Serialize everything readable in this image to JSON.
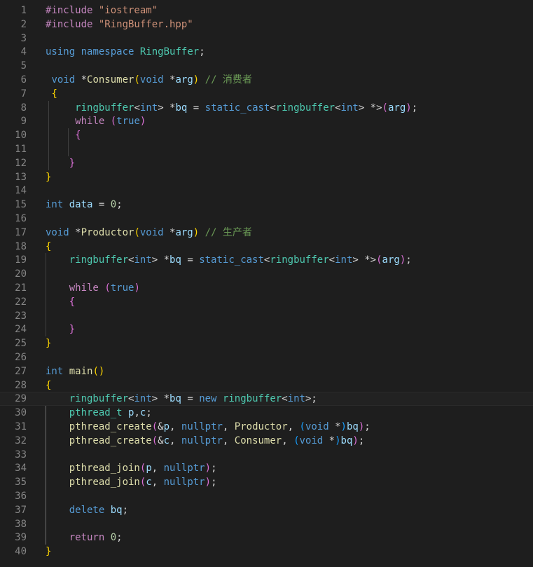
{
  "editor": {
    "language": "cpp",
    "theme_colors": {
      "background": "#1e1e1e",
      "line_number": "#858585",
      "keyword": "#569cd6",
      "control": "#c586c0",
      "type": "#4ec9b0",
      "function": "#dcdcaa",
      "variable": "#9cdcfe",
      "string": "#ce9178",
      "number": "#b5cea8",
      "comment": "#6a9955",
      "bracket_level_1": "#ffd700",
      "bracket_level_2": "#da70d6",
      "bracket_level_3": "#179fff"
    },
    "current_line": 29,
    "lines": [
      {
        "n": "1",
        "tokens": [
          [
            "pp",
            "#include "
          ],
          [
            "str",
            "\"iostream\""
          ]
        ]
      },
      {
        "n": "2",
        "tokens": [
          [
            "pp",
            "#include "
          ],
          [
            "str",
            "\"RingBuffer.hpp\""
          ]
        ]
      },
      {
        "n": "3",
        "tokens": []
      },
      {
        "n": "4",
        "tokens": [
          [
            "kw",
            "using"
          ],
          [
            "plain",
            " "
          ],
          [
            "kw",
            "namespace"
          ],
          [
            "plain",
            " "
          ],
          [
            "ty",
            "RingBuffer"
          ],
          [
            "plain",
            ";"
          ]
        ]
      },
      {
        "n": "5",
        "tokens": []
      },
      {
        "n": "6",
        "tokens": [
          [
            "plain",
            " "
          ],
          [
            "kw",
            "void"
          ],
          [
            "plain",
            " *"
          ],
          [
            "fn",
            "Consumer"
          ],
          [
            "b1",
            "("
          ],
          [
            "kw",
            "void"
          ],
          [
            "plain",
            " *"
          ],
          [
            "var",
            "arg"
          ],
          [
            "b1",
            ")"
          ],
          [
            "plain",
            " "
          ],
          [
            "cmt",
            "// 消费者"
          ]
        ]
      },
      {
        "n": "7",
        "tokens": [
          [
            "plain",
            " "
          ],
          [
            "b1",
            "{"
          ]
        ]
      },
      {
        "n": "8",
        "tokens": [
          [
            "plain",
            "     "
          ],
          [
            "ty",
            "ringbuffer"
          ],
          [
            "plain",
            "<"
          ],
          [
            "kw",
            "int"
          ],
          [
            "plain",
            "> *"
          ],
          [
            "var",
            "bq"
          ],
          [
            "plain",
            " = "
          ],
          [
            "kw",
            "static_cast"
          ],
          [
            "plain",
            "<"
          ],
          [
            "ty",
            "ringbuffer"
          ],
          [
            "plain",
            "<"
          ],
          [
            "kw",
            "int"
          ],
          [
            "plain",
            "> *>"
          ],
          [
            "b2",
            "("
          ],
          [
            "var",
            "arg"
          ],
          [
            "b2",
            ")"
          ],
          [
            "plain",
            ";"
          ]
        ]
      },
      {
        "n": "9",
        "tokens": [
          [
            "plain",
            "     "
          ],
          [
            "ctl",
            "while"
          ],
          [
            "plain",
            " "
          ],
          [
            "b2",
            "("
          ],
          [
            "kw",
            "true"
          ],
          [
            "b2",
            ")"
          ]
        ]
      },
      {
        "n": "10",
        "tokens": [
          [
            "plain",
            "     "
          ],
          [
            "b2",
            "{"
          ]
        ]
      },
      {
        "n": "11",
        "tokens": []
      },
      {
        "n": "12",
        "tokens": [
          [
            "plain",
            "    "
          ],
          [
            "b2",
            "}"
          ]
        ]
      },
      {
        "n": "13",
        "tokens": [
          [
            "b1",
            "}"
          ]
        ]
      },
      {
        "n": "14",
        "tokens": []
      },
      {
        "n": "15",
        "tokens": [
          [
            "kw",
            "int"
          ],
          [
            "plain",
            " "
          ],
          [
            "var",
            "data"
          ],
          [
            "plain",
            " = "
          ],
          [
            "num",
            "0"
          ],
          [
            "plain",
            ";"
          ]
        ]
      },
      {
        "n": "16",
        "tokens": []
      },
      {
        "n": "17",
        "tokens": [
          [
            "kw",
            "void"
          ],
          [
            "plain",
            " *"
          ],
          [
            "fn",
            "Productor"
          ],
          [
            "b1",
            "("
          ],
          [
            "kw",
            "void"
          ],
          [
            "plain",
            " *"
          ],
          [
            "var",
            "arg"
          ],
          [
            "b1",
            ")"
          ],
          [
            "plain",
            " "
          ],
          [
            "cmt",
            "// 生产者"
          ]
        ]
      },
      {
        "n": "18",
        "tokens": [
          [
            "b1",
            "{"
          ]
        ]
      },
      {
        "n": "19",
        "tokens": [
          [
            "plain",
            "    "
          ],
          [
            "ty",
            "ringbuffer"
          ],
          [
            "plain",
            "<"
          ],
          [
            "kw",
            "int"
          ],
          [
            "plain",
            "> *"
          ],
          [
            "var",
            "bq"
          ],
          [
            "plain",
            " = "
          ],
          [
            "kw",
            "static_cast"
          ],
          [
            "plain",
            "<"
          ],
          [
            "ty",
            "ringbuffer"
          ],
          [
            "plain",
            "<"
          ],
          [
            "kw",
            "int"
          ],
          [
            "plain",
            "> *>"
          ],
          [
            "b2",
            "("
          ],
          [
            "var",
            "arg"
          ],
          [
            "b2",
            ")"
          ],
          [
            "plain",
            ";"
          ]
        ]
      },
      {
        "n": "20",
        "tokens": []
      },
      {
        "n": "21",
        "tokens": [
          [
            "plain",
            "    "
          ],
          [
            "ctl",
            "while"
          ],
          [
            "plain",
            " "
          ],
          [
            "b2",
            "("
          ],
          [
            "kw",
            "true"
          ],
          [
            "b2",
            ")"
          ]
        ]
      },
      {
        "n": "22",
        "tokens": [
          [
            "plain",
            "    "
          ],
          [
            "b2",
            "{"
          ]
        ]
      },
      {
        "n": "23",
        "tokens": []
      },
      {
        "n": "24",
        "tokens": [
          [
            "plain",
            "    "
          ],
          [
            "b2",
            "}"
          ]
        ]
      },
      {
        "n": "25",
        "tokens": [
          [
            "b1",
            "}"
          ]
        ]
      },
      {
        "n": "26",
        "tokens": []
      },
      {
        "n": "27",
        "tokens": [
          [
            "kw",
            "int"
          ],
          [
            "plain",
            " "
          ],
          [
            "fn",
            "main"
          ],
          [
            "b1",
            "()"
          ]
        ]
      },
      {
        "n": "28",
        "tokens": [
          [
            "b1",
            "{"
          ]
        ]
      },
      {
        "n": "29",
        "tokens": [
          [
            "plain",
            "    "
          ],
          [
            "ty",
            "ringbuffer"
          ],
          [
            "plain",
            "<"
          ],
          [
            "kw",
            "int"
          ],
          [
            "plain",
            "> *"
          ],
          [
            "var",
            "bq"
          ],
          [
            "plain",
            " = "
          ],
          [
            "kw",
            "new"
          ],
          [
            "plain",
            " "
          ],
          [
            "ty",
            "ringbuffer"
          ],
          [
            "plain",
            "<"
          ],
          [
            "kw",
            "int"
          ],
          [
            "plain",
            ">;"
          ]
        ]
      },
      {
        "n": "30",
        "tokens": [
          [
            "plain",
            "    "
          ],
          [
            "ty",
            "pthread_t"
          ],
          [
            "plain",
            " "
          ],
          [
            "var",
            "p"
          ],
          [
            "plain",
            ","
          ],
          [
            "var",
            "c"
          ],
          [
            "plain",
            ";"
          ]
        ]
      },
      {
        "n": "31",
        "tokens": [
          [
            "plain",
            "    "
          ],
          [
            "fn",
            "pthread_create"
          ],
          [
            "b2",
            "("
          ],
          [
            "plain",
            "&"
          ],
          [
            "var",
            "p"
          ],
          [
            "plain",
            ", "
          ],
          [
            "kw",
            "nullptr"
          ],
          [
            "plain",
            ", "
          ],
          [
            "fn",
            "Productor"
          ],
          [
            "plain",
            ", "
          ],
          [
            "b3",
            "("
          ],
          [
            "kw",
            "void"
          ],
          [
            "plain",
            " *"
          ],
          [
            "b3",
            ")"
          ],
          [
            "var",
            "bq"
          ],
          [
            "b2",
            ")"
          ],
          [
            "plain",
            ";"
          ]
        ]
      },
      {
        "n": "32",
        "tokens": [
          [
            "plain",
            "    "
          ],
          [
            "fn",
            "pthread_create"
          ],
          [
            "b2",
            "("
          ],
          [
            "plain",
            "&"
          ],
          [
            "var",
            "c"
          ],
          [
            "plain",
            ", "
          ],
          [
            "kw",
            "nullptr"
          ],
          [
            "plain",
            ", "
          ],
          [
            "fn",
            "Consumer"
          ],
          [
            "plain",
            ", "
          ],
          [
            "b3",
            "("
          ],
          [
            "kw",
            "void"
          ],
          [
            "plain",
            " *"
          ],
          [
            "b3",
            ")"
          ],
          [
            "var",
            "bq"
          ],
          [
            "b2",
            ")"
          ],
          [
            "plain",
            ";"
          ]
        ]
      },
      {
        "n": "33",
        "tokens": []
      },
      {
        "n": "34",
        "tokens": [
          [
            "plain",
            "    "
          ],
          [
            "fn",
            "pthread_join"
          ],
          [
            "b2",
            "("
          ],
          [
            "var",
            "p"
          ],
          [
            "plain",
            ", "
          ],
          [
            "kw",
            "nullptr"
          ],
          [
            "b2",
            ")"
          ],
          [
            "plain",
            ";"
          ]
        ]
      },
      {
        "n": "35",
        "tokens": [
          [
            "plain",
            "    "
          ],
          [
            "fn",
            "pthread_join"
          ],
          [
            "b2",
            "("
          ],
          [
            "var",
            "c"
          ],
          [
            "plain",
            ", "
          ],
          [
            "kw",
            "nullptr"
          ],
          [
            "b2",
            ")"
          ],
          [
            "plain",
            ";"
          ]
        ]
      },
      {
        "n": "36",
        "tokens": []
      },
      {
        "n": "37",
        "tokens": [
          [
            "plain",
            "    "
          ],
          [
            "kw",
            "delete"
          ],
          [
            "plain",
            " "
          ],
          [
            "var",
            "bq"
          ],
          [
            "plain",
            ";"
          ]
        ]
      },
      {
        "n": "38",
        "tokens": []
      },
      {
        "n": "39",
        "tokens": [
          [
            "plain",
            "    "
          ],
          [
            "ctl",
            "return"
          ],
          [
            "plain",
            " "
          ],
          [
            "num",
            "0"
          ],
          [
            "plain",
            ";"
          ]
        ]
      },
      {
        "n": "40",
        "tokens": [
          [
            "b1",
            "}"
          ]
        ]
      }
    ]
  }
}
